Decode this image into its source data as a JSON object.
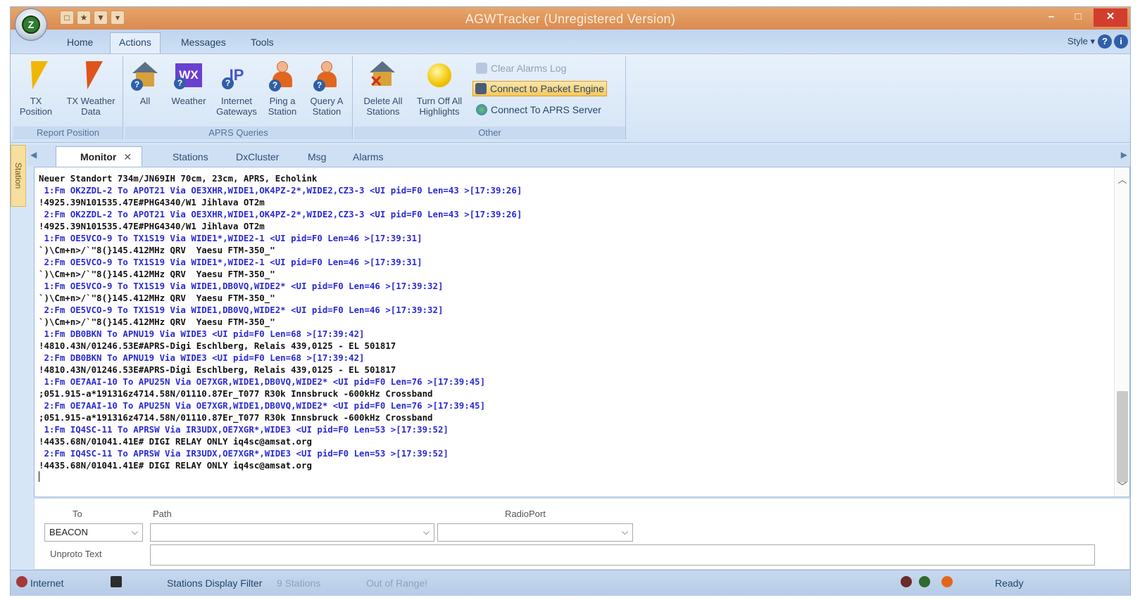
{
  "window": {
    "title": "AGWTracker (Unregistered Version)",
    "quick_access": [
      "□",
      "★",
      "▼",
      "▾"
    ],
    "controls": [
      "–",
      "□",
      "✕"
    ]
  },
  "menu": {
    "tabs": [
      "Home",
      "Actions",
      "Messages",
      "Tools"
    ],
    "active": "Actions",
    "style_label": "Style ▾",
    "help": "?",
    "info": "i"
  },
  "ribbon": {
    "report_position": {
      "label": "Report Position",
      "buttons": [
        "TX\nPosition",
        "TX Weather\nData"
      ]
    },
    "aprs_queries": {
      "label": "APRS Queries",
      "buttons": [
        "All",
        "Weather",
        "Internet\nGateways",
        "Ping a\nStation",
        "Query A\nStation"
      ],
      "wx": "WX",
      "ip": "IP"
    },
    "other": {
      "label": "Other",
      "buttons": [
        "Delete All\nStations",
        "Turn Off All\nHighlights"
      ],
      "small": [
        "Clear Alarms Log",
        "Connect to Packet Engine",
        "Connect To APRS Server"
      ]
    }
  },
  "side_tab": "Station",
  "doc_tabs": [
    "Monitor",
    "Stations",
    "DxCluster",
    "Msg",
    "Alarms"
  ],
  "monitor": {
    "lines": [
      {
        "t": "data",
        "s": "Neuer Standort 734m/JN69IH 70cm, 23cm, APRS, Echolink"
      },
      {
        "t": "hdr",
        "s": " 1:Fm OK2ZDL-2 To APOT21 Via OE3XHR,WIDE1,OK4PZ-2*,WIDE2,CZ3-3 <UI pid=F0 Len=43 >[17:39:26]"
      },
      {
        "t": "data",
        "s": "!4925.39N101535.47E#PHG4340/W1 Jihlava OT2m"
      },
      {
        "t": "hdr",
        "s": " 2:Fm OK2ZDL-2 To APOT21 Via OE3XHR,WIDE1,OK4PZ-2*,WIDE2,CZ3-3 <UI pid=F0 Len=43 >[17:39:26]"
      },
      {
        "t": "data",
        "s": "!4925.39N101535.47E#PHG4340/W1 Jihlava OT2m"
      },
      {
        "t": "hdr",
        "s": " 1:Fm OE5VCO-9 To TX1S19 Via WIDE1*,WIDE2-1 <UI pid=F0 Len=46 >[17:39:31]"
      },
      {
        "t": "data",
        "s": "`)\\Cm+n>/`\"8(}145.412MHz QRV  Yaesu FTM-350_\""
      },
      {
        "t": "hdr",
        "s": " 2:Fm OE5VCO-9 To TX1S19 Via WIDE1*,WIDE2-1 <UI pid=F0 Len=46 >[17:39:31]"
      },
      {
        "t": "data",
        "s": "`)\\Cm+n>/`\"8(}145.412MHz QRV  Yaesu FTM-350_\""
      },
      {
        "t": "hdr",
        "s": " 1:Fm OE5VCO-9 To TX1S19 Via WIDE1,DB0VQ,WIDE2* <UI pid=F0 Len=46 >[17:39:32]"
      },
      {
        "t": "data",
        "s": "`)\\Cm+n>/`\"8(}145.412MHz QRV  Yaesu FTM-350_\""
      },
      {
        "t": "hdr",
        "s": " 2:Fm OE5VCO-9 To TX1S19 Via WIDE1,DB0VQ,WIDE2* <UI pid=F0 Len=46 >[17:39:32]"
      },
      {
        "t": "data",
        "s": "`)\\Cm+n>/`\"8(}145.412MHz QRV  Yaesu FTM-350_\""
      },
      {
        "t": "hdr",
        "s": " 1:Fm DB0BKN To APNU19 Via WIDE3 <UI pid=F0 Len=68 >[17:39:42]"
      },
      {
        "t": "data",
        "s": "!4810.43N/01246.53E#APRS-Digi Eschlberg, Relais 439,0125 - EL 501817"
      },
      {
        "t": "hdr",
        "s": " 2:Fm DB0BKN To APNU19 Via WIDE3 <UI pid=F0 Len=68 >[17:39:42]"
      },
      {
        "t": "data",
        "s": "!4810.43N/01246.53E#APRS-Digi Eschlberg, Relais 439,0125 - EL 501817"
      },
      {
        "t": "hdr",
        "s": " 1:Fm OE7AAI-10 To APU25N Via OE7XGR,WIDE1,DB0VQ,WIDE2* <UI pid=F0 Len=76 >[17:39:45]"
      },
      {
        "t": "data",
        "s": ";051.915-a*191316z4714.58N/01110.87Er_T077 R30k Innsbruck -600kHz Crossband"
      },
      {
        "t": "hdr",
        "s": " 2:Fm OE7AAI-10 To APU25N Via OE7XGR,WIDE1,DB0VQ,WIDE2* <UI pid=F0 Len=76 >[17:39:45]"
      },
      {
        "t": "data",
        "s": ";051.915-a*191316z4714.58N/01110.87Er_T077 R30k Innsbruck -600kHz Crossband"
      },
      {
        "t": "hdr",
        "s": " 1:Fm IQ4SC-11 To APRSW Via IR3UDX,OE7XGR*,WIDE3 <UI pid=F0 Len=53 >[17:39:52]"
      },
      {
        "t": "data",
        "s": "!4435.68N/01041.41E# DIGI RELAY ONLY iq4sc@amsat.org"
      },
      {
        "t": "hdr",
        "s": " 2:Fm IQ4SC-11 To APRSW Via IR3UDX,OE7XGR*,WIDE3 <UI pid=F0 Len=53 >[17:39:52]"
      },
      {
        "t": "data",
        "s": "!4435.68N/01041.41E# DIGI RELAY ONLY iq4sc@amsat.org"
      }
    ]
  },
  "form": {
    "to_label": "To",
    "to_value": "BEACON",
    "path_label": "Path",
    "path_value": "",
    "radioport_label": "RadioPort",
    "radioport_value": "",
    "unproto_label": "Unproto Text",
    "unproto_value": ""
  },
  "status": {
    "internet": "Internet",
    "filter": "Stations Display Filter",
    "stations": "9 Stations",
    "range": "Out of Range!",
    "ready": "Ready"
  },
  "colors": {
    "header_line": "#2a2ad6",
    "data_line": "#111111",
    "title_bar": "#db8a4f",
    "ribbon": "#d4e4f6"
  }
}
